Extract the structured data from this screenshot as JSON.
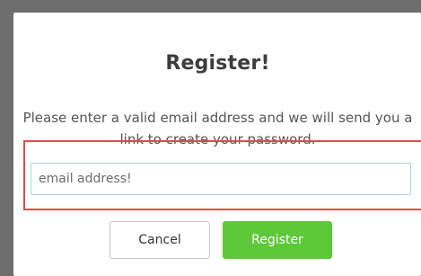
{
  "modal": {
    "title": "Register!",
    "message": "Please enter a valid email address and we will send you a link to create your password.",
    "email": {
      "value": "",
      "placeholder": "email address!"
    },
    "cancel_label": "Cancel",
    "register_label": "Register"
  },
  "colors": {
    "register_button": "#5ec83b",
    "highlight_outline": "#e04a4a",
    "input_border": "#a9d3ee"
  }
}
